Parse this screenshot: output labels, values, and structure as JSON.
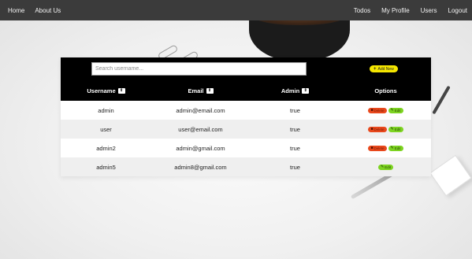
{
  "nav": {
    "left": [
      "Home",
      "About Us"
    ],
    "right": [
      "Todos",
      "My Profile",
      "Users",
      "Logout"
    ]
  },
  "search": {
    "placeholder": "Search username..."
  },
  "add_button": {
    "label": "Add New",
    "icon": "plus-icon",
    "color": "#f5e600"
  },
  "table": {
    "headers": [
      "Username",
      "Email",
      "Admin",
      "Options"
    ],
    "sort_icon": "sort-icon",
    "rows": [
      {
        "username": "admin",
        "email": "admin@email.com",
        "admin": "true",
        "actions": [
          "Delete",
          "Edit"
        ]
      },
      {
        "username": "user",
        "email": "user@email.com",
        "admin": "true",
        "actions": [
          "Delete",
          "Edit"
        ]
      },
      {
        "username": "admin2",
        "email": "admin@gmail.com",
        "admin": "true",
        "actions": [
          "Delete",
          "Edit"
        ]
      },
      {
        "username": "admin5",
        "email": "admin8@gmail.com",
        "admin": "true",
        "actions": [
          "Edit"
        ]
      }
    ]
  },
  "colors": {
    "navbar": "#3b3b3b",
    "table_header": "#000000",
    "delete": "#e8481c",
    "edit": "#7dd321"
  }
}
